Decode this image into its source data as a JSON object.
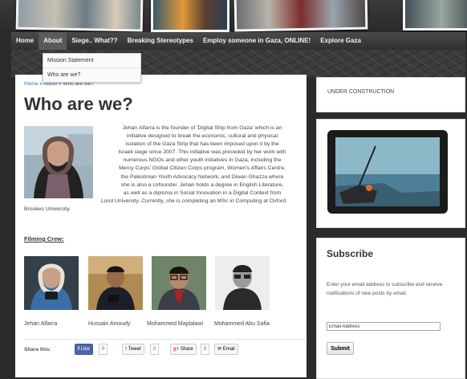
{
  "nav": {
    "items": [
      "Home",
      "About",
      "Siege.. What??",
      "Breaking Stereotypes",
      "Employ someone in Gaza, ONLINE!",
      "Explore Gaza"
    ],
    "dropdown": [
      "Mission Statement",
      "Who are we?"
    ]
  },
  "breadcrumb": {
    "home": "Home",
    "sep": "»",
    "about": "About",
    "current": "Who are we?"
  },
  "page_title": "Who are we?",
  "bio": {
    "line1": "Jehan Alfarra is the founder of 'Digital Ship from Gaza' which is an",
    "line2": "initiative designed to break the economic, cultural and physical",
    "line3": "isolation of the Gaza Strip that has been imposed upon it by the",
    "line4": "Israeli siege since 2007. This initiative was preceded by her work with",
    "line5": "numerous NGOs and other youth initiatives in Gaza, including the",
    "line6": "Mercy Corps' Global Citizen Corps program, Women's Affairs Centre,",
    "line7": "the Palestinian Youth Advocacy Network, and Diwan Ghazza where",
    "line8": "she is also a cofounder. Jehan holds a degree in English Literature,",
    "line9": "as well as a diploma in Social Innovation in a Digital Context from",
    "line10": "Lund University. Currently, she is completing an MSc in Computing at Oxford Brookes University."
  },
  "crew": {
    "heading": "Filming Crew:",
    "members": [
      "Jehan Alfarra",
      "Hussain Amoudy",
      "Mohammed Majdalawi",
      "Mohammed Abu Safia"
    ]
  },
  "share": {
    "label": "Share this:",
    "like": "Like",
    "like_count": "0",
    "tweet": "Tweet",
    "tweet_count": "0",
    "gplus": "Share",
    "gplus_count": "0",
    "email": "Email"
  },
  "sidebar": {
    "under_construction": "UNDER CONSTRUCTION",
    "subscribe_title": "Subscribe",
    "subscribe_text": "Enter your email address to subscribe and receive notifications of new posts by email.",
    "email_value": "Email Address",
    "submit": "Submit"
  },
  "colors": {
    "link": "#2a6fb8",
    "nav_bg": "#3a3a3a",
    "facebook": "#3b5998",
    "twitter": "#2aa3ef",
    "gplus": "#dd4b39"
  }
}
